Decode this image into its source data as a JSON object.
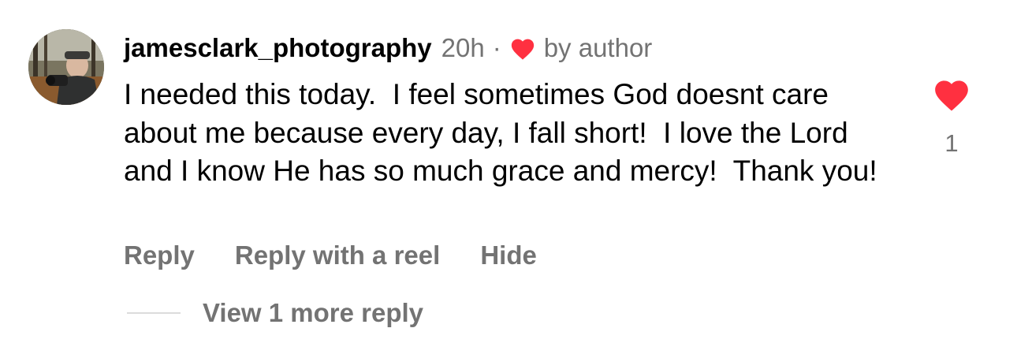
{
  "comment": {
    "username": "jamesclark_photography",
    "time": "20h",
    "separator": "·",
    "author_badge": "by author",
    "text": "I needed this today.  I feel sometimes God doesnt care about me because every day, I fall short!  I love the Lord and I know He has so much grace and mercy!  Thank you!",
    "like_count": "1",
    "avatar_icon": "profile-photo",
    "author_like_icon": "heart-icon",
    "like_icon": "heart-filled-icon"
  },
  "actions": {
    "reply": "Reply",
    "reply_with_reel": "Reply with a reel",
    "hide": "Hide"
  },
  "replies": {
    "view_more": "View 1 more reply"
  },
  "colors": {
    "heart": "#ff3040",
    "secondary_text": "#737373",
    "primary_text": "#000000",
    "divider": "#dbdbdb"
  }
}
